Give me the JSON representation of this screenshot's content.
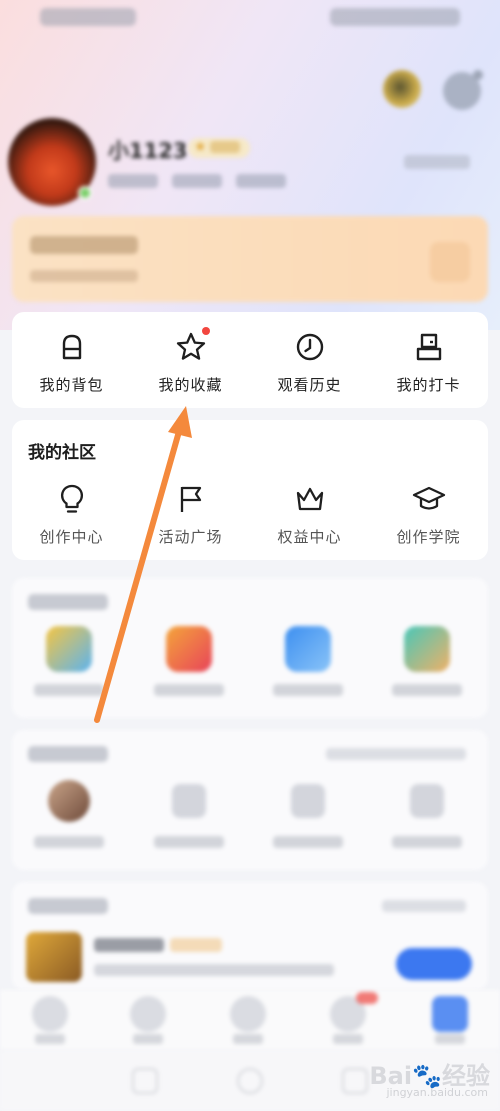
{
  "profile": {
    "username": "小1123"
  },
  "quick_actions": [
    {
      "label": "我的背包",
      "icon": "backpack-icon",
      "has_dot": false
    },
    {
      "label": "我的收藏",
      "icon": "star-icon",
      "has_dot": true
    },
    {
      "label": "观看历史",
      "icon": "clock-icon",
      "has_dot": false
    },
    {
      "label": "我的打卡",
      "icon": "checkin-icon",
      "has_dot": false
    }
  ],
  "community": {
    "title": "我的社区",
    "items": [
      {
        "label": "创作中心",
        "icon": "lightbulb-icon"
      },
      {
        "label": "活动广场",
        "icon": "flag-icon"
      },
      {
        "label": "权益中心",
        "icon": "crown-icon"
      },
      {
        "label": "创作学院",
        "icon": "graduation-cap-icon"
      }
    ]
  },
  "colors": {
    "accent_red_dot": "#f2463f",
    "annotation_arrow": "#f4893c",
    "primary_blue": "#3c78f0"
  },
  "watermark": {
    "text": "Bai",
    "text2": "经验",
    "sub": "jingyan.baidu.com"
  }
}
